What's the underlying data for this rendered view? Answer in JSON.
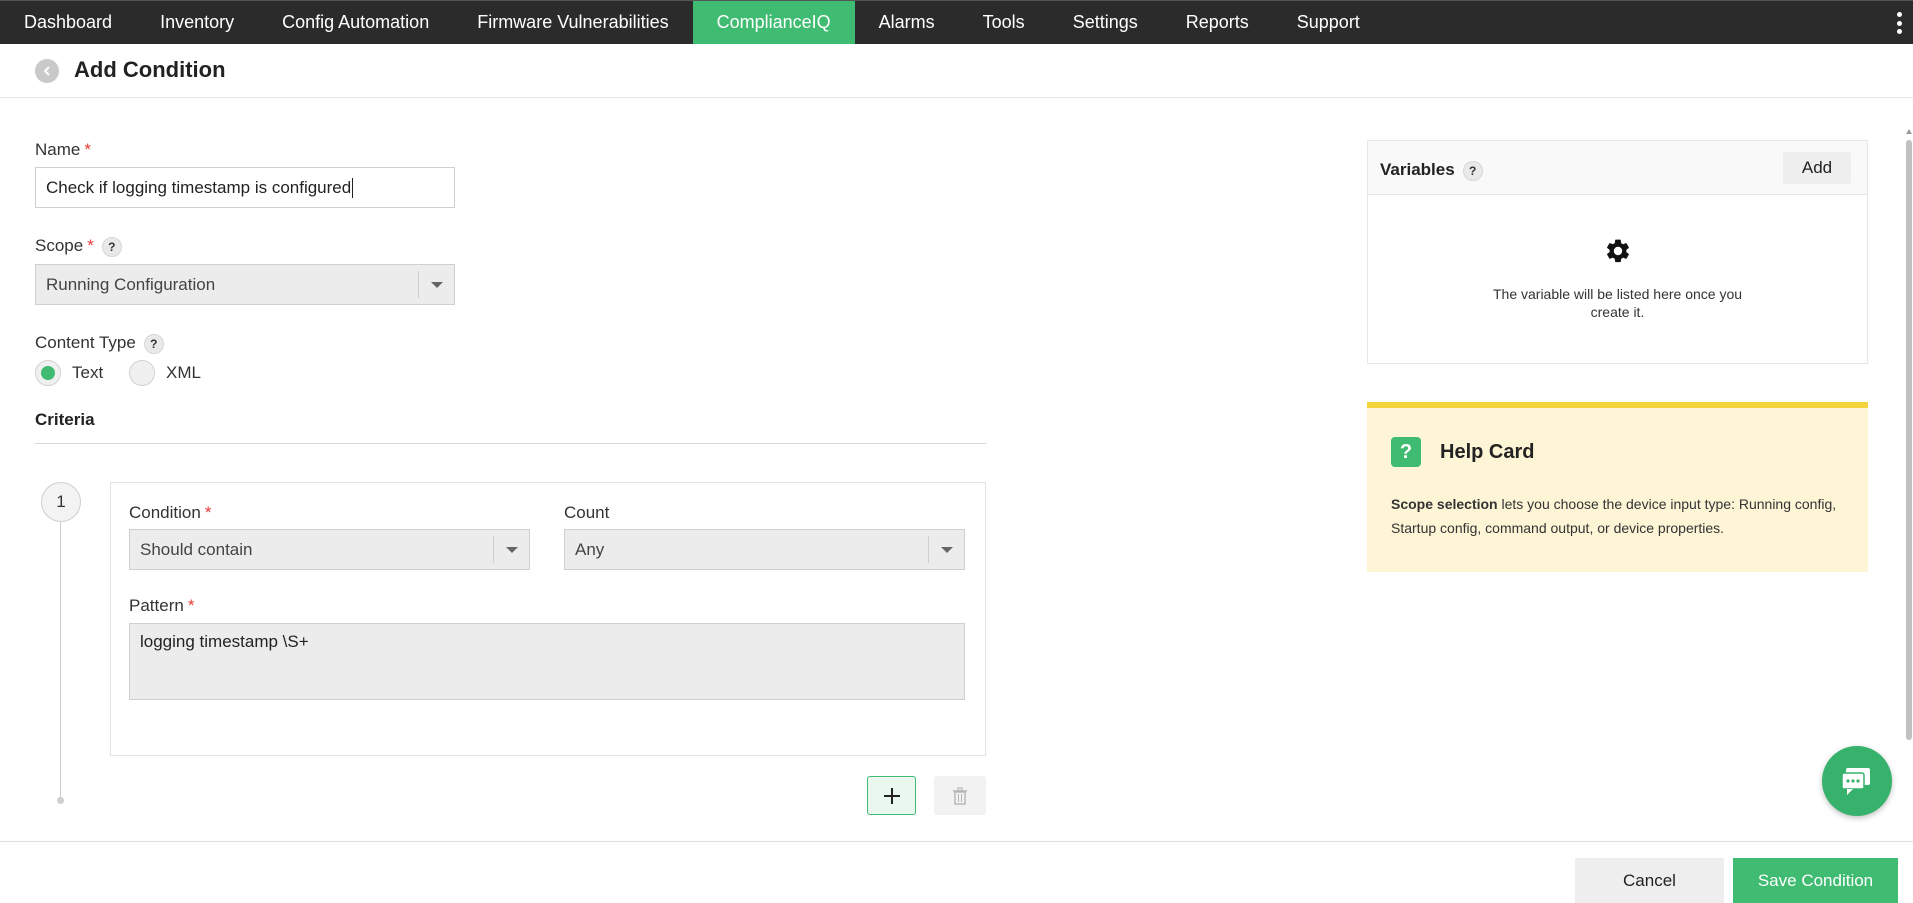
{
  "nav": {
    "items": [
      {
        "label": "Dashboard"
      },
      {
        "label": "Inventory"
      },
      {
        "label": "Config Automation"
      },
      {
        "label": "Firmware Vulnerabilities"
      },
      {
        "label": "ComplianceIQ"
      },
      {
        "label": "Alarms"
      },
      {
        "label": "Tools"
      },
      {
        "label": "Settings"
      },
      {
        "label": "Reports"
      },
      {
        "label": "Support"
      }
    ],
    "active": "ComplianceIQ"
  },
  "page": {
    "title": "Add Condition"
  },
  "form": {
    "name_label": "Name",
    "name_value": "Check if logging timestamp is configured",
    "scope_label": "Scope",
    "scope_value": "Running Configuration",
    "content_type_label": "Content Type",
    "content_type_options": [
      "Text",
      "XML"
    ],
    "content_type_selected": "Text",
    "criteria_label": "Criteria",
    "required_mark": "*",
    "help_mark": "?"
  },
  "criteria": {
    "step_number": "1",
    "condition_label": "Condition",
    "condition_value": "Should contain",
    "count_label": "Count",
    "count_value": "Any",
    "pattern_label": "Pattern",
    "pattern_value": "logging timestamp \\S+"
  },
  "variables": {
    "title": "Variables",
    "add_label": "Add",
    "empty_text_line1": "The variable will be listed here once you",
    "empty_text_line2": "create it."
  },
  "help_card": {
    "icon_text": "?",
    "title": "Help Card",
    "bold_text": "Scope selection",
    "body_text": " lets you choose the device input type: Running config, Startup config, command output, or device properties."
  },
  "footer": {
    "cancel_label": "Cancel",
    "save_label": "Save Condition"
  },
  "colors": {
    "accent": "#3fbb72",
    "nav_bg": "#2b2b2b",
    "help_card_bg": "#fdf5d6",
    "help_card_border": "#f5d33a",
    "required": "#e53935"
  }
}
